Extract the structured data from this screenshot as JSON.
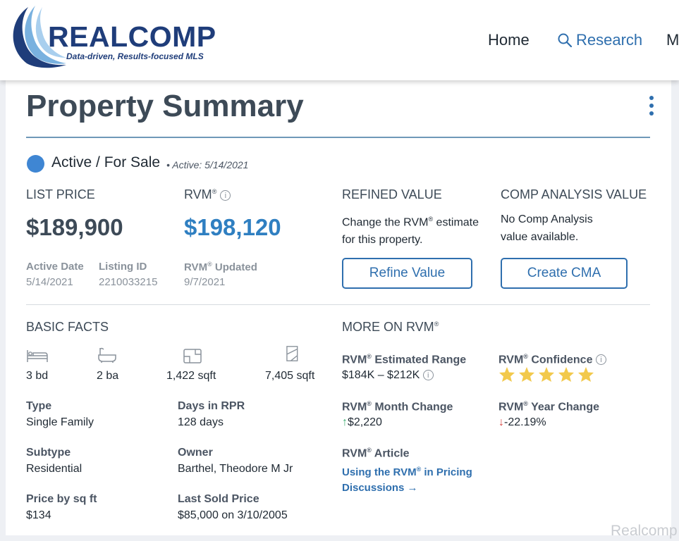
{
  "header": {
    "logo_text": "REALCOMP",
    "logo_tagline": "Data-driven, Results-focused MLS",
    "nav": {
      "home": "Home",
      "research": "Research",
      "more": "M"
    }
  },
  "summary": {
    "title": "Property Summary",
    "status": "Active / For Sale",
    "status_sub": "• Active: 5/14/2021"
  },
  "pricing": {
    "list_price_label": "LIST PRICE",
    "list_price": "$189,900",
    "rvm_label": "RVM",
    "rvm_value": "$198,120",
    "active_date_label": "Active Date",
    "active_date": "5/14/2021",
    "listing_id_label": "Listing ID",
    "listing_id": "2210033215",
    "rvm_updated_label": "Updated",
    "rvm_updated": "9/7/2021"
  },
  "refined": {
    "label": "REFINED VALUE",
    "desc_1a": "Change the RVM",
    "desc_1b": " estimate",
    "desc_2": "for this property.",
    "button": "Refine Value"
  },
  "comp": {
    "label": "COMP ANALYSIS VALUE",
    "desc_1": "No Comp Analysis",
    "desc_2": "value available.",
    "button": "Create CMA"
  },
  "basic_facts": {
    "label": "BASIC FACTS",
    "beds": "3 bd",
    "baths": "2 ba",
    "sqft": "1,422 sqft",
    "lot": "7,405 sqft",
    "type_label": "Type",
    "type": "Single Family",
    "days_label": "Days in RPR",
    "days": "128 days",
    "subtype_label": "Subtype",
    "subtype": "Residential",
    "owner_label": "Owner",
    "owner": "Barthel, Theodore M Jr",
    "ppsf_label": "Price by sq ft",
    "ppsf": "$134",
    "last_sold_label": "Last Sold Price",
    "last_sold": "$85,000",
    "last_sold_on": " on 3/10/2005"
  },
  "more_rvm": {
    "label": "MORE ON RVM",
    "range_label": " Estimated Range",
    "range": "$184K – $212K",
    "confidence_label": " Confidence",
    "confidence_stars": 5,
    "month_label": " Month Change",
    "month_change": "$2,220",
    "year_label": " Year Change",
    "year_change": "-22.19%",
    "article_label": " Article",
    "article_link_1a": "Using the RVM",
    "article_link_1b": " in Pricing",
    "article_link_2": "Discussions"
  },
  "common": {
    "rvm": "RVM",
    "reg": "®",
    "star_color": "#f2c94c",
    "accent": "#2f6fae"
  },
  "watermark": "Realcomp"
}
